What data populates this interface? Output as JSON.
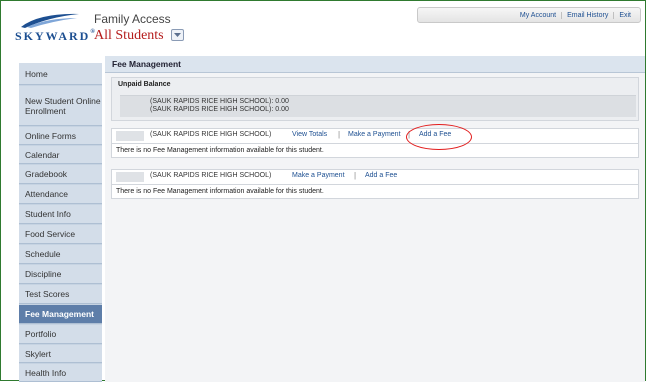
{
  "header": {
    "logo_text": "SKYWARD",
    "logo_tm": "®",
    "app_title": "Family Access",
    "student_selector": "All Students",
    "top_links": [
      "My Account",
      "Email History",
      "Exit"
    ]
  },
  "sidebar": {
    "items": [
      {
        "label": "Home",
        "active": false
      },
      {
        "label": "New Student Online Enrollment",
        "active": false
      },
      {
        "label": "Online Forms",
        "active": false
      },
      {
        "label": "Calendar",
        "active": false
      },
      {
        "label": "Gradebook",
        "active": false
      },
      {
        "label": "Attendance",
        "active": false
      },
      {
        "label": "Student Info",
        "active": false
      },
      {
        "label": "Food Service",
        "active": false
      },
      {
        "label": "Schedule",
        "active": false
      },
      {
        "label": "Discipline",
        "active": false
      },
      {
        "label": "Test Scores",
        "active": false
      },
      {
        "label": "Fee Management",
        "active": true
      },
      {
        "label": "Portfolio",
        "active": false
      },
      {
        "label": "Skylert",
        "active": false
      },
      {
        "label": "Health Info",
        "active": false
      }
    ]
  },
  "main": {
    "title": "Fee Management",
    "unpaid": {
      "title": "Unpaid Balance",
      "rows": [
        {
          "school": "(SAUK RAPIDS RICE HIGH SCHOOL):",
          "amount": "0.00"
        },
        {
          "school": "(SAUK RAPIDS RICE HIGH SCHOOL):",
          "amount": "0.00"
        }
      ]
    },
    "sections": [
      {
        "school": "(SAUK RAPIDS RICE HIGH SCHOOL)",
        "links": [
          "View Totals",
          "Make a Payment",
          "Add a Fee"
        ],
        "message": "There is no Fee Management information available for this student."
      },
      {
        "school": "(SAUK RAPIDS RICE HIGH SCHOOL)",
        "links": [
          "Make a Payment",
          "Add a Fee"
        ],
        "message": "There is no Fee Management information available for this student."
      }
    ]
  },
  "colors": {
    "highlight_circle": "#e21c1c",
    "link": "#1d4f91",
    "active_nav": "#5e7ea9",
    "student_selector": "#b51c1c"
  }
}
